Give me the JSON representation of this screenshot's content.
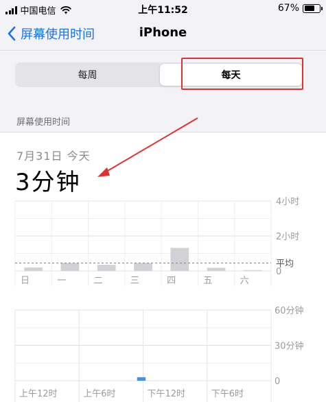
{
  "status_bar": {
    "carrier": "中国电信",
    "time": "上午11:52",
    "battery": "67%",
    "battery_level": 0.67
  },
  "nav": {
    "back_label": "屏幕使用时间",
    "title": "iPhone"
  },
  "segmented": {
    "week_label": "每周",
    "day_label": "每天",
    "selected": "每天"
  },
  "section_header": "屏幕使用时间",
  "summary": {
    "date": "7月31日 今天",
    "total": "3分钟"
  },
  "colors": {
    "accent": "#1a73e8",
    "bar": "#d1d1d6",
    "annotation": "#e03131",
    "today_bar": "#4a90e2"
  },
  "chart_data": [
    {
      "type": "bar",
      "title": "",
      "categories": [
        "日",
        "一",
        "二",
        "三",
        "四",
        "五",
        "六"
      ],
      "values": [
        0.2,
        0.45,
        0.35,
        0.45,
        1.32,
        0.18,
        0.05
      ],
      "unit": "小时",
      "ylim": [
        0,
        4
      ],
      "y_tick_labels": [
        "4小时",
        "2小时",
        "0"
      ],
      "average_label": "平均",
      "average": 0.45
    },
    {
      "type": "bar",
      "title": "",
      "x_tick_labels": [
        "上午12时",
        "上午6时",
        "下午12时",
        "下午6时"
      ],
      "y_tick_labels": [
        "60分钟",
        "30分钟",
        "0"
      ],
      "ylim": [
        0,
        60
      ],
      "bars": [
        {
          "hour": 11.5,
          "value": 3
        }
      ]
    }
  ]
}
